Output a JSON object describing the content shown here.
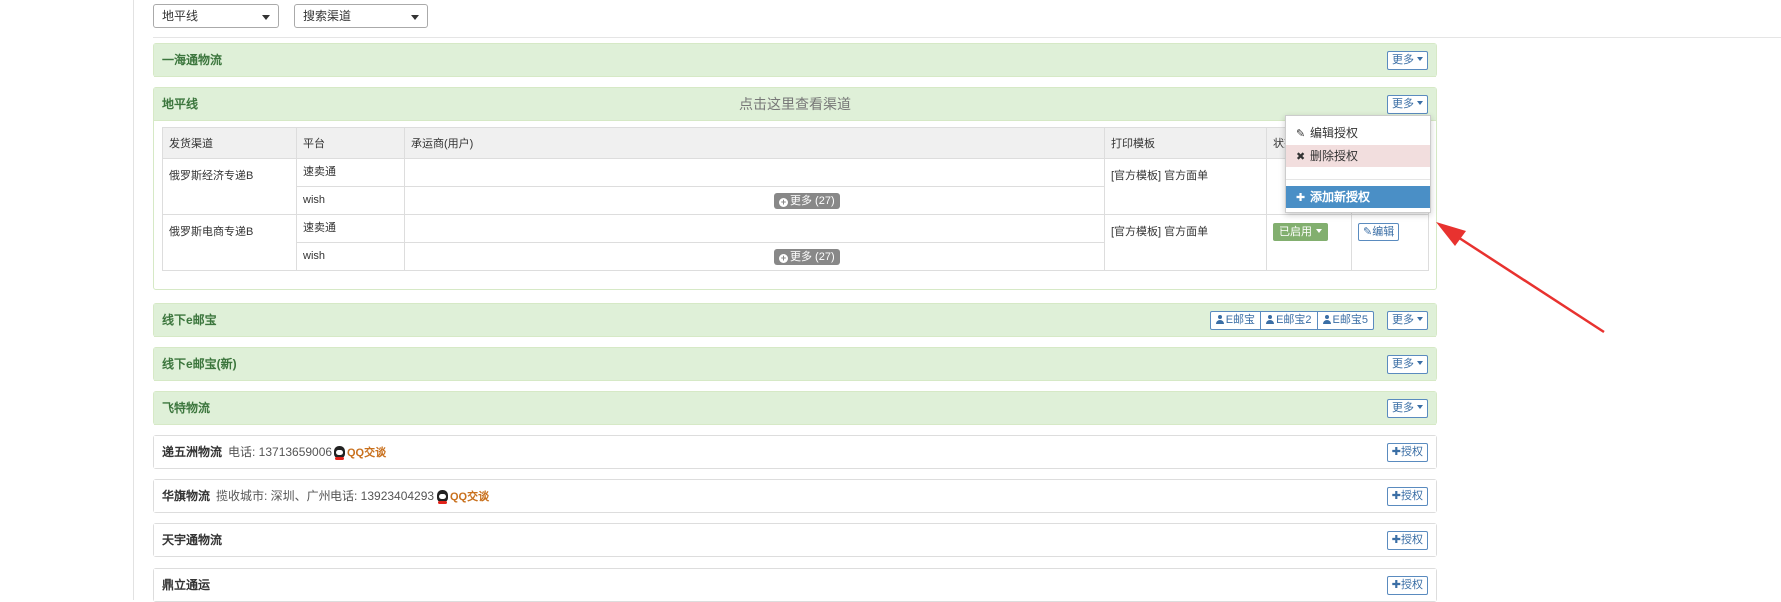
{
  "filters": {
    "first_select": "地平线",
    "second_select": "搜索渠道"
  },
  "panels": {
    "yihaitong": {
      "title": "一海通物流",
      "more": "更多"
    },
    "dipingxian": {
      "title": "地平线",
      "center_link": "点击这里查看渠道",
      "more": "更多"
    },
    "xianxia_eyoubao": {
      "title": "线下e邮宝",
      "accounts": [
        "E邮宝",
        "E邮宝2",
        "E邮宝5"
      ],
      "more": "更多"
    },
    "xianxia_eyoubao_new": {
      "title": "线下e邮宝(新)",
      "more": "更多"
    },
    "feite": {
      "title": "飞特物流",
      "more": "更多"
    }
  },
  "table": {
    "headers": [
      "发货渠道",
      "平台",
      "承运商(用户)",
      "打印模板",
      "状态",
      ""
    ],
    "rows": [
      {
        "channel": "俄罗斯经济专递B",
        "platform_1": "速卖通",
        "platform_2": "wish",
        "more_pill": "更多 (27)",
        "template": "[官方模板] 官方面单"
      },
      {
        "channel": "俄罗斯电商专递B",
        "platform_1": "速卖通",
        "platform_2": "wish",
        "more_pill": "更多 (27)",
        "template": "[官方模板] 官方面单",
        "status": "已启用",
        "edit": "编辑"
      }
    ]
  },
  "dropdown": {
    "edit_auth": "编辑授权",
    "delete_auth": "删除授权",
    "add_auth": "添加新授权"
  },
  "carriers": [
    {
      "name": "递五洲物流",
      "info": "电话: 13713659006",
      "qq": "QQ交谈",
      "button": "授权"
    },
    {
      "name": "华旗物流",
      "info": "揽收城市: 深圳、广州",
      "info2": "电话: 13923404293",
      "qq": "QQ交谈",
      "button": "授权"
    },
    {
      "name": "天宇通物流",
      "button": "授权"
    },
    {
      "name": "鼎立通运",
      "button": "授权"
    }
  ],
  "colors": {
    "panel_header": "#dff0d8",
    "panel_title": "#3c763d",
    "button_blue": "#3a6ea5",
    "status_green": "#82af6f",
    "menu_active": "#4a8fc6",
    "annotation_arrow": "#e8322f"
  },
  "icons": {
    "caret": "chevron-down-icon",
    "user": "user-icon",
    "edit": "edit-icon",
    "delete": "close-icon",
    "add": "plus-icon",
    "qq": "qq-icon"
  }
}
